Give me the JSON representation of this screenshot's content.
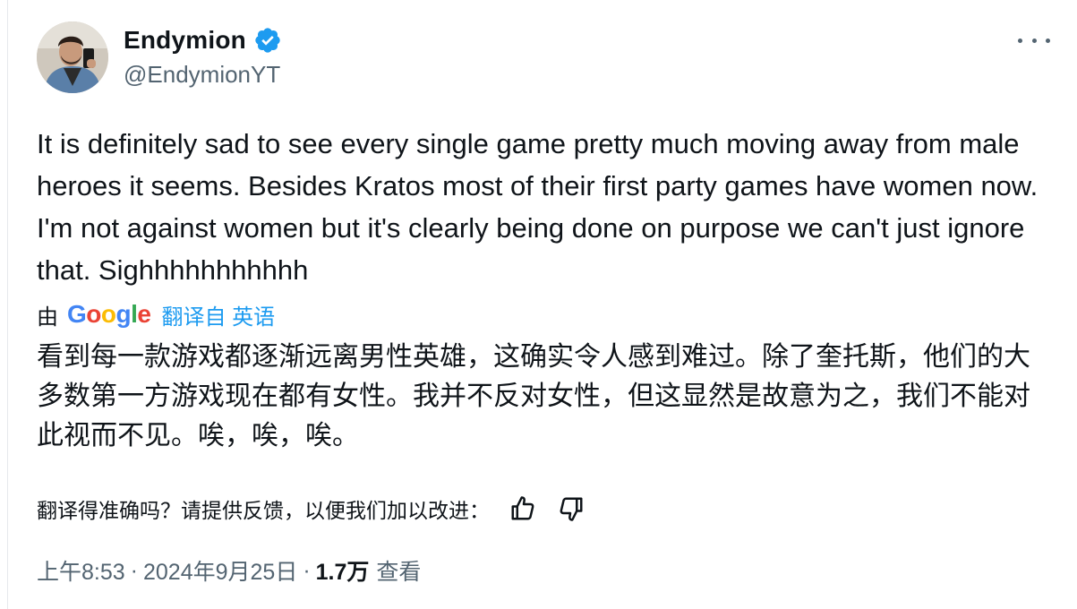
{
  "author": {
    "display_name": "Endymion",
    "handle": "@EndymionYT",
    "verified": true,
    "verified_color": "#1d9bf0",
    "avatar_icon": "person-avatar"
  },
  "menu": {
    "icon": "more-horizontal-icon"
  },
  "tweet": {
    "text": "It is definitely sad to see every single game pretty much moving away from male heroes it seems. Besides Kratos most of their first party games have women now. I'm not against women but it's clearly being done on purpose we can't just ignore that. Sighhhhhhhhhhh"
  },
  "translation": {
    "by_label": "由",
    "provider": "Google",
    "link_label": "翻译自 英语",
    "text": "看到每一款游戏都逐渐远离男性英雄，这确实令人感到难过。除了奎托斯，他们的大多数第一方游戏现在都有女性。我并不反对女性，但这显然是故意为之，我们不能对此视而不见。唉，唉，唉。",
    "feedback_prompt": "翻译得准确吗？请提供反馈，以便我们加以改进："
  },
  "meta": {
    "time": "上午8:53",
    "separator": "·",
    "date": "2024年9月25日",
    "views_count": "1.7万",
    "views_label": "查看"
  },
  "colors": {
    "text_primary": "#0f1419",
    "text_secondary": "#536471",
    "accent": "#1d9bf0"
  }
}
